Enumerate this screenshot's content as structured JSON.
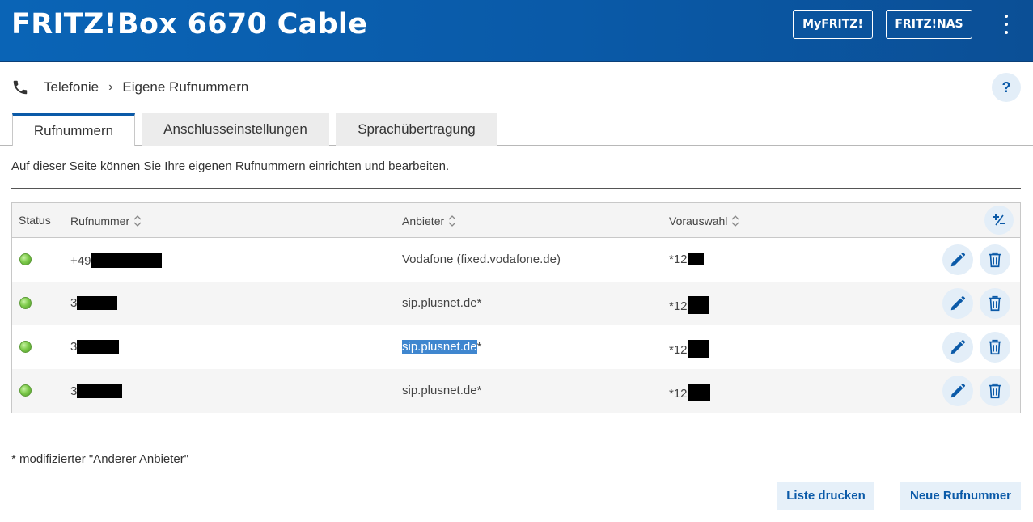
{
  "header": {
    "title": "FRITZ!Box 6670 Cable",
    "myfritz_label": "MyFRITZ!",
    "fritznas_label": "FRITZ!NAS",
    "menu_icon": "kebab-menu-icon"
  },
  "breadcrumb": {
    "icon": "phone-icon",
    "items": [
      "Telefonie",
      "Eigene Rufnummern"
    ],
    "help_label": "?"
  },
  "tabs": [
    {
      "label": "Rufnummern",
      "active": true
    },
    {
      "label": "Anschlusseinstellungen",
      "active": false
    },
    {
      "label": "Sprachübertragung",
      "active": false
    }
  ],
  "intro_text": "Auf dieser Seite können Sie Ihre eigenen Rufnummern einrichten und bearbeiten.",
  "table": {
    "headers": {
      "status": "Status",
      "number": "Rufnummer",
      "provider": "Anbieter",
      "preselect": "Vorauswahl"
    },
    "rows": [
      {
        "number_prefix": "+49",
        "provider": "Vodafone (fixed.vodafone.de)",
        "provider_suffix": "",
        "preselect_prefix": "*12"
      },
      {
        "number_prefix": "3",
        "provider": "sip.plusnet.de",
        "provider_suffix": "*",
        "preselect_prefix": "*12"
      },
      {
        "number_prefix": "3",
        "provider": "sip.plusnet.de",
        "provider_suffix": "*",
        "preselect_prefix": "*12"
      },
      {
        "number_prefix": "3",
        "provider": "sip.plusnet.de",
        "provider_suffix": "*",
        "preselect_prefix": "*12"
      }
    ]
  },
  "footnote": "* modifizierter \"Anderer Anbieter\"",
  "buttons": {
    "print_label": "Liste drucken",
    "new_label": "Neue Rufnummer"
  },
  "colors": {
    "header_blue": "#0a5aa8",
    "accent": "#0b5aa8",
    "status_ok": "#7fcc4c",
    "button_bg": "#e6f0f9"
  }
}
